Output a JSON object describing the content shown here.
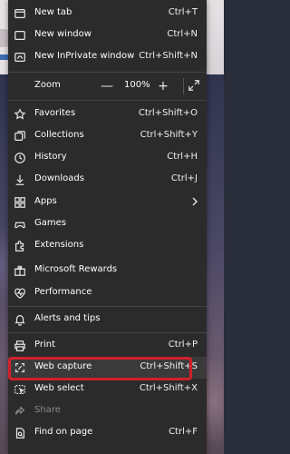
{
  "menu": {
    "items": [
      {
        "name": "new-tab",
        "icon": "new-tab-icon",
        "label": "New tab",
        "shortcut": "Ctrl+T"
      },
      {
        "name": "new-window",
        "icon": "new-window-icon",
        "label": "New window",
        "shortcut": "Ctrl+N"
      },
      {
        "name": "new-inprivate-window",
        "icon": "inprivate-icon",
        "label": "New InPrivate window",
        "shortcut": "Ctrl+Shift+N"
      },
      {
        "name": "favorites",
        "icon": "star-icon",
        "label": "Favorites",
        "shortcut": "Ctrl+Shift+O"
      },
      {
        "name": "collections",
        "icon": "collections-icon",
        "label": "Collections",
        "shortcut": "Ctrl+Shift+Y"
      },
      {
        "name": "history",
        "icon": "history-icon",
        "label": "History",
        "shortcut": "Ctrl+H"
      },
      {
        "name": "downloads",
        "icon": "download-icon",
        "label": "Downloads",
        "shortcut": "Ctrl+J"
      },
      {
        "name": "apps",
        "icon": "apps-icon",
        "label": "Apps",
        "shortcut": ""
      },
      {
        "name": "games",
        "icon": "games-icon",
        "label": "Games",
        "shortcut": ""
      },
      {
        "name": "extensions",
        "icon": "extensions-icon",
        "label": "Extensions",
        "shortcut": ""
      },
      {
        "name": "microsoft-rewards",
        "icon": "rewards-icon",
        "label": "Microsoft Rewards",
        "shortcut": ""
      },
      {
        "name": "performance",
        "icon": "performance-icon",
        "label": "Performance",
        "shortcut": ""
      },
      {
        "name": "alerts-and-tips",
        "icon": "bell-icon",
        "label": "Alerts and tips",
        "shortcut": ""
      },
      {
        "name": "print",
        "icon": "printer-icon",
        "label": "Print",
        "shortcut": "Ctrl+P"
      },
      {
        "name": "web-capture",
        "icon": "web-capture-icon",
        "label": "Web capture",
        "shortcut": "Ctrl+Shift+S"
      },
      {
        "name": "web-select",
        "icon": "web-select-icon",
        "label": "Web select",
        "shortcut": "Ctrl+Shift+X"
      },
      {
        "name": "share",
        "icon": "share-icon",
        "label": "Share",
        "shortcut": ""
      },
      {
        "name": "find-on-page",
        "icon": "find-icon",
        "label": "Find on page",
        "shortcut": "Ctrl+F"
      }
    ],
    "zoom": {
      "label": "Zoom",
      "minus": "—",
      "value": "100%",
      "plus": "+"
    }
  },
  "colors": {
    "menu_bg": "#2b2b2b",
    "highlight_border": "#d2202a",
    "text": "#ffffff",
    "disabled_text": "#8a8a8a"
  }
}
